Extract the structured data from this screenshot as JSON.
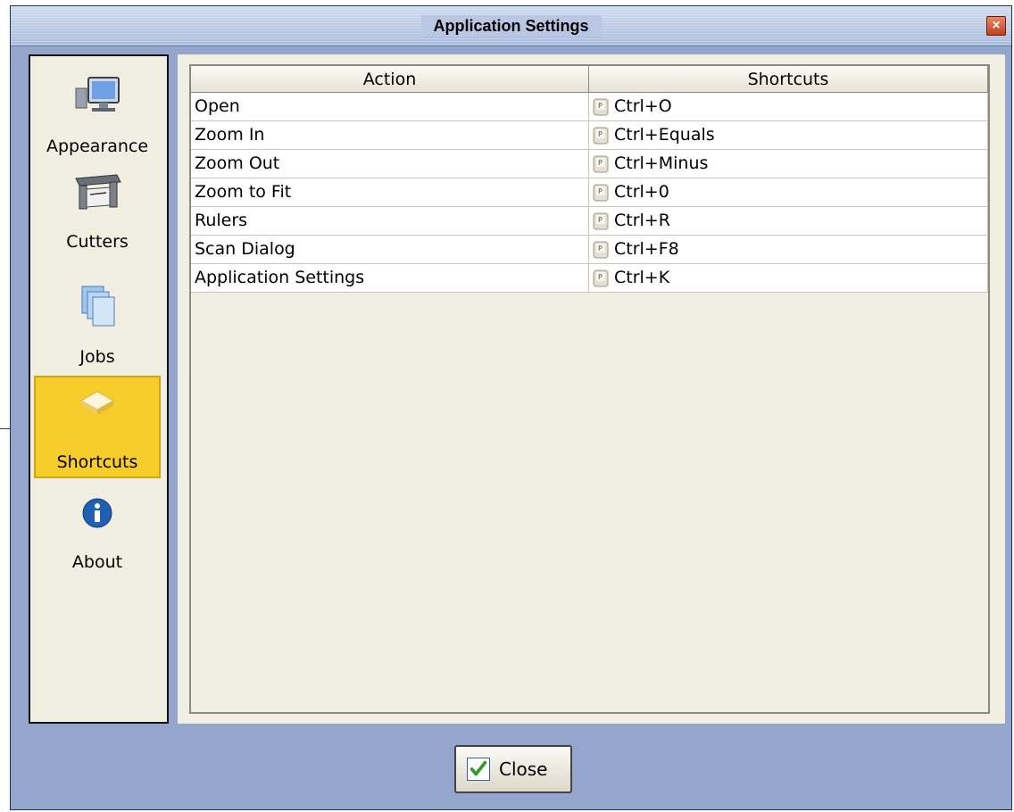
{
  "window": {
    "title": "Application Settings",
    "close_icon": "close-icon"
  },
  "sidebar": {
    "items": [
      {
        "label": "Appearance",
        "icon": "monitor-icon",
        "selected": false
      },
      {
        "label": "Cutters",
        "icon": "cutter-icon",
        "selected": false
      },
      {
        "label": "Jobs",
        "icon": "documents-icon",
        "selected": false
      },
      {
        "label": "Shortcuts",
        "icon": "keyboard-key-icon",
        "selected": true
      },
      {
        "label": "About",
        "icon": "info-icon",
        "selected": false
      }
    ]
  },
  "table": {
    "columns": [
      "Action",
      "Shortcuts"
    ],
    "rows": [
      {
        "action": "Open",
        "shortcut": "Ctrl+O",
        "icon": "key-icon"
      },
      {
        "action": "Zoom In",
        "shortcut": "Ctrl+Equals",
        "icon": "key-icon"
      },
      {
        "action": "Zoom Out",
        "shortcut": "Ctrl+Minus",
        "icon": "key-icon"
      },
      {
        "action": "Zoom to Fit",
        "shortcut": "Ctrl+0",
        "icon": "key-icon"
      },
      {
        "action": "Rulers",
        "shortcut": "Ctrl+R",
        "icon": "key-icon"
      },
      {
        "action": "Scan Dialog",
        "shortcut": "Ctrl+F8",
        "icon": "key-icon"
      },
      {
        "action": "Application Settings",
        "shortcut": "Ctrl+K",
        "icon": "key-icon"
      }
    ]
  },
  "footer": {
    "close_label": "Close",
    "close_icon": "checkmark-icon"
  },
  "colors": {
    "window_bg": "#94a6cb",
    "panel_bg": "#f1eee2",
    "selected_bg": "#f6cd2b"
  }
}
